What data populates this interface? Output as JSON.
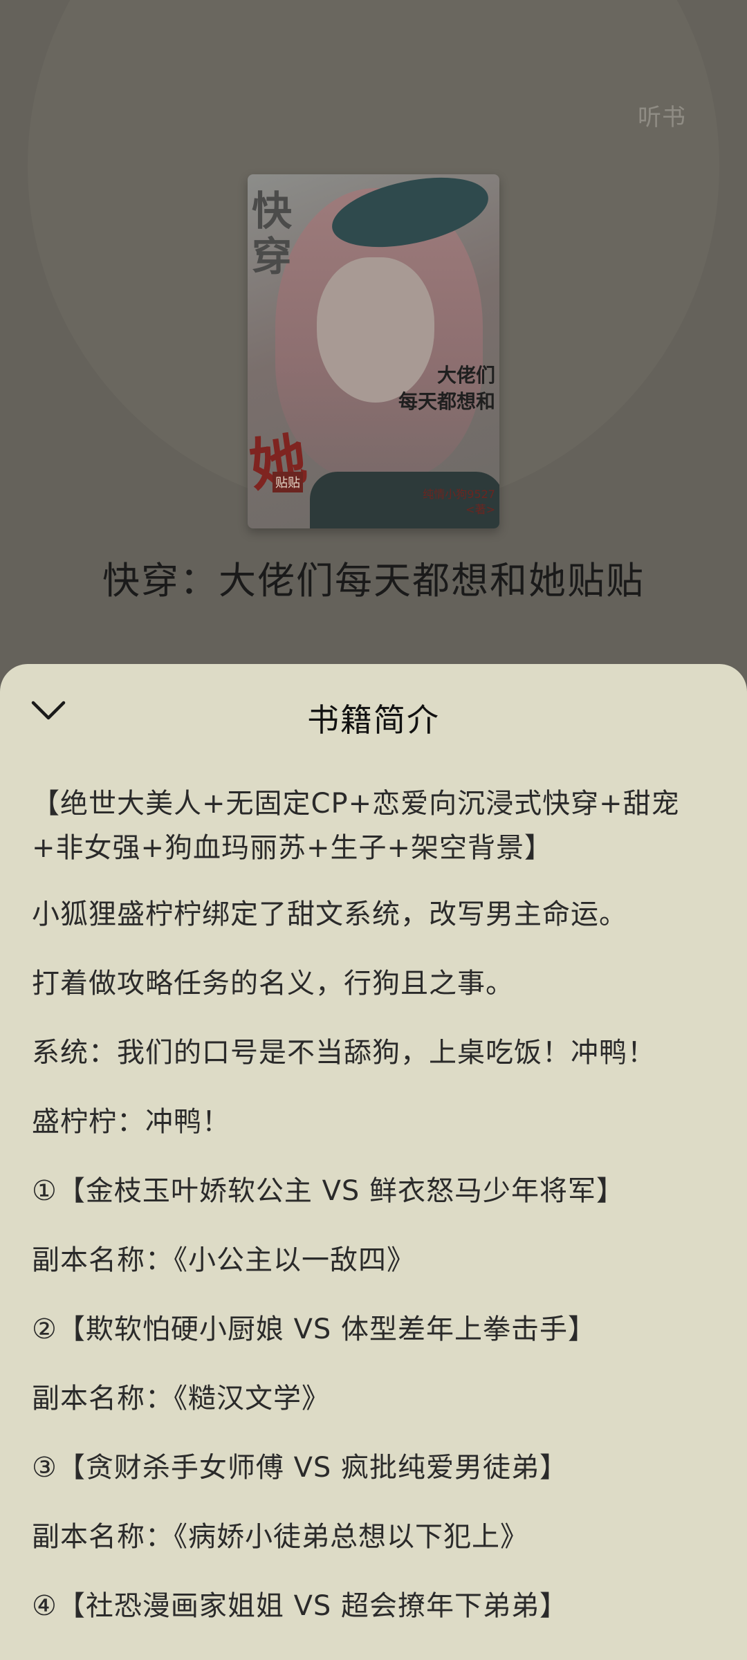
{
  "header": {
    "listen_label": "听书"
  },
  "cover": {
    "title_vertical": "快穿",
    "title_right_line1": "大佬们",
    "title_right_line2": "每天都想和",
    "title_big": "她",
    "title_small": "贴贴",
    "author_line1": "纯情小狗9527",
    "author_line2": "<著>"
  },
  "book": {
    "title": "快穿：大佬们每天都想和她贴贴"
  },
  "sheet": {
    "title": "书籍简介",
    "paragraphs": [
      "【绝世大美人+无固定CP+恋爱向沉浸式快穿+甜宠+非女强+狗血玛丽苏+生子+架空背景】",
      "小狐狸盛柠柠绑定了甜文系统，改写男主命运。",
      "打着做攻略任务的名义，行狗且之事。",
      "系统：我们的口号是不当舔狗，上桌吃饭！冲鸭！",
      "盛柠柠：冲鸭！",
      "①【金枝玉叶娇软公主 VS 鲜衣怒马少年将军】",
      "副本名称：《小公主以一敌四》",
      "②【欺软怕硬小厨娘 VS 体型差年上拳击手】",
      "副本名称：《糙汉文学》",
      "③【贪财杀手女师傅 VS 疯批纯爱男徒弟】",
      "副本名称：《病娇小徒弟总想以下犯上》",
      "④【社恐漫画家姐姐 VS 超会撩年下弟弟】"
    ]
  },
  "colors": {
    "backdrop": "#65625b",
    "sheet_bg": "#dddbc6",
    "text": "#2a2a2a"
  }
}
